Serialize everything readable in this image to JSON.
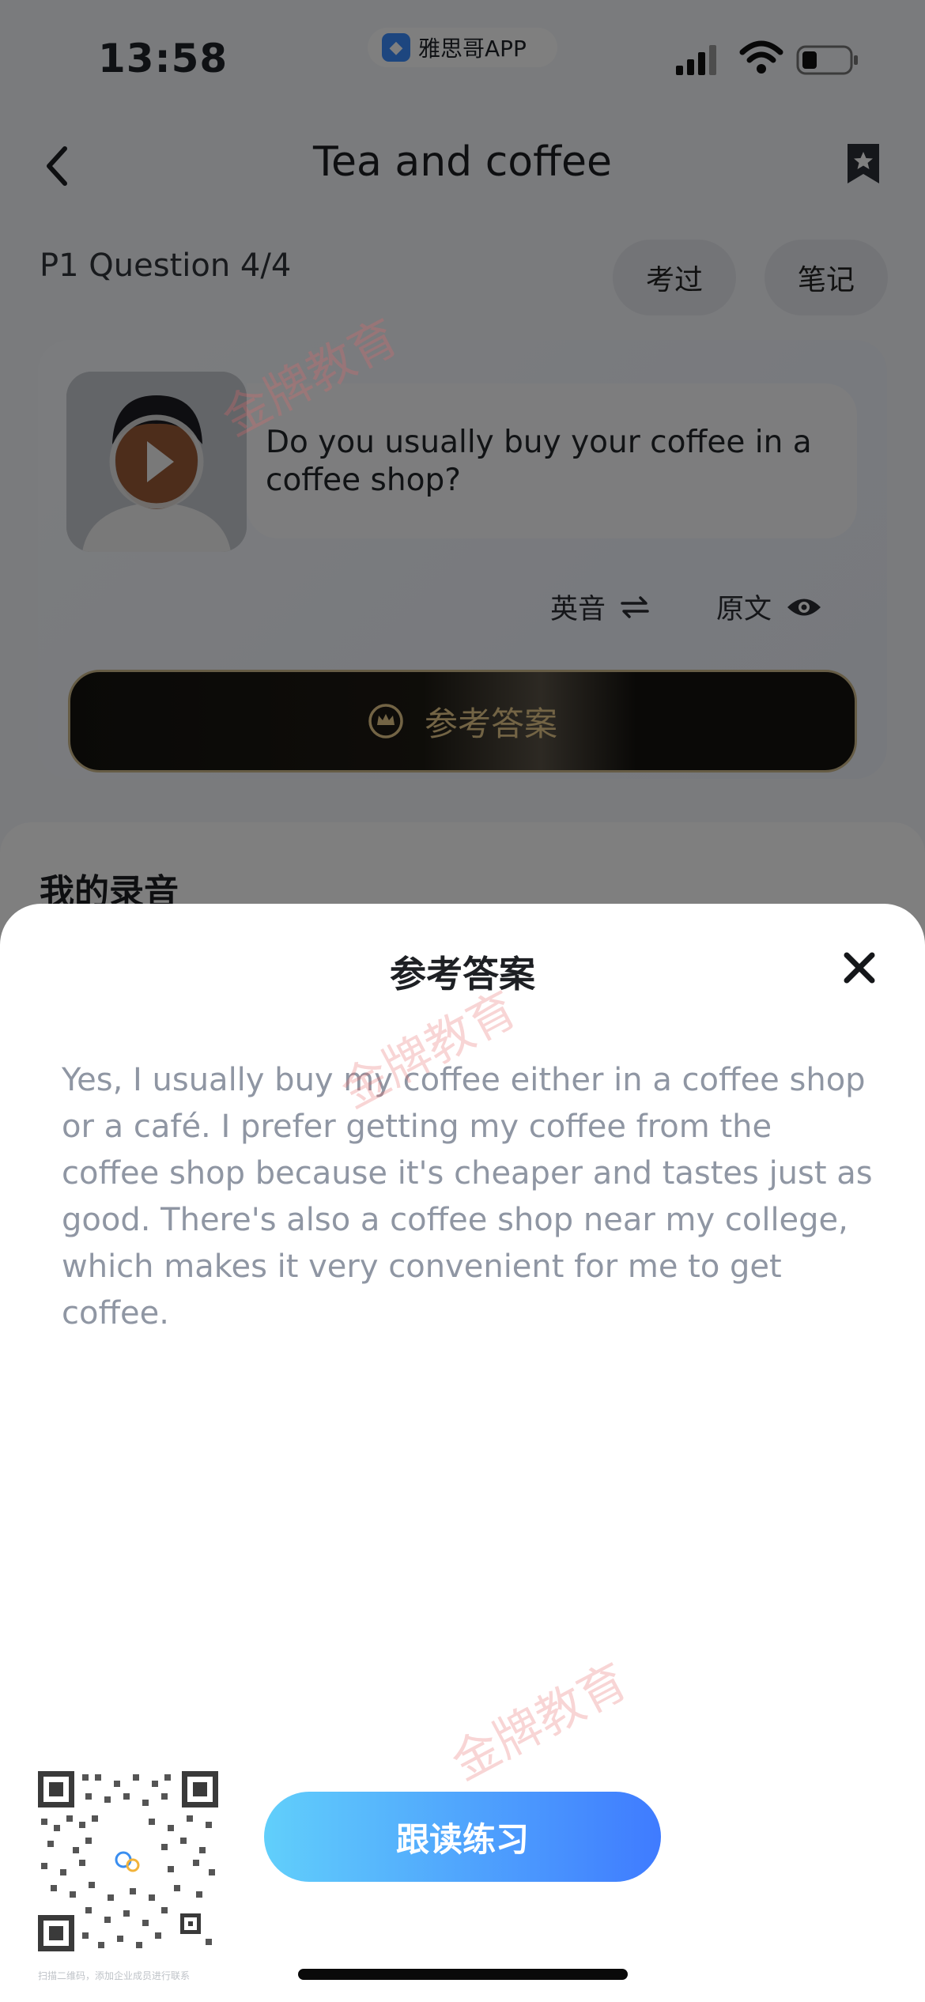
{
  "status_bar": {
    "time": "13:58",
    "app_pill": "雅思哥APP"
  },
  "header": {
    "title": "Tea and coffee"
  },
  "question": {
    "number_label": "P1 Question 4/4",
    "chip_tested": "考过",
    "chip_notes": "笔记",
    "text": "Do you usually buy your coffee in a coffee shop?",
    "accent_toggle": "英音",
    "original_toggle": "原文",
    "reference_button": "参考答案"
  },
  "recording_section": {
    "title": "我的录音"
  },
  "sheet": {
    "title": "参考答案",
    "answer_text": "Yes, I usually buy my coffee either in a coffee shop or a café. I prefer getting my coffee from the coffee shop because it's cheaper and tastes just as good. There's also a coffee shop near my college, which makes it very convenient for me to get coffee.",
    "practice_button": "跟读练习",
    "qr_caption": "扫描二维码，添加企业成员进行联系"
  },
  "watermark": "金牌教育",
  "colors": {
    "primary_gradient_start": "#61cffb",
    "primary_gradient_end": "#3f7bff",
    "gold": "#e6c98a",
    "answer_text": "#8f96a3"
  }
}
